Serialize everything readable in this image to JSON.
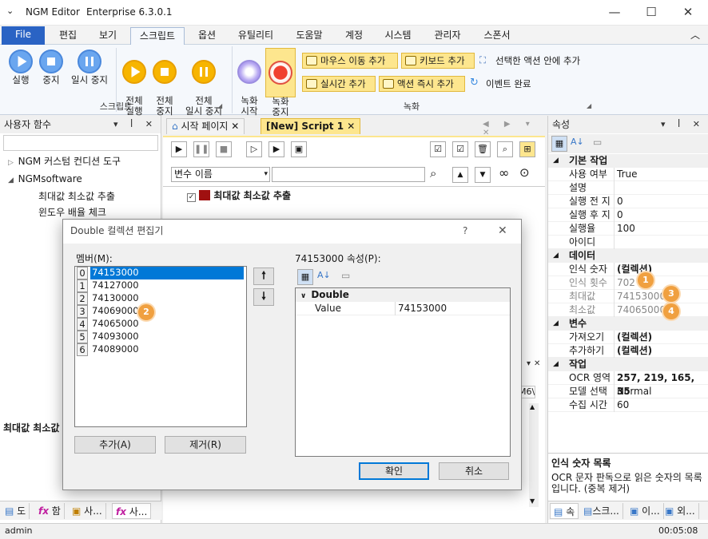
{
  "window": {
    "title": "NGM Editor",
    "edition": "Enterprise 6.3.0.1",
    "min": "—",
    "max": "☐",
    "close": "✕"
  },
  "menu": {
    "items": [
      "File",
      "편집",
      "보기",
      "스크립트",
      "옵션",
      "유틸리티",
      "도움말",
      "계정",
      "시스템",
      "관리자",
      "스폰서"
    ],
    "collapse": "︿"
  },
  "ribbon": {
    "script_buttons": [
      {
        "label": "실행"
      },
      {
        "label": "중지"
      },
      {
        "label": "일시 중지"
      }
    ],
    "full_buttons": [
      {
        "label": "전체\n실행"
      },
      {
        "label": "전체\n중지"
      },
      {
        "label": "전체\n일시 중지"
      }
    ],
    "record_buttons": [
      {
        "label": "녹화\n시작"
      },
      {
        "label": "녹화\n중지"
      }
    ],
    "actions": [
      "마우스 이동 추가",
      "키보드 추가",
      "선택한 액션 안에 추가",
      "실시간 추가",
      "액션 즉시 추가",
      "이벤트 완료"
    ],
    "group_script": "스크립트",
    "group_record": "녹화"
  },
  "left_panel": {
    "title": "사용자 함수",
    "pin": "▾ ✕",
    "tree": [
      "NGM 커스텀 컨디션 도구",
      "NGMsoftware",
      "최대값 최소값 추출",
      "윈도우 배율 체크"
    ],
    "bottom_label": "최대값 최소값 추출",
    "tabs": [
      "도",
      "함",
      "사...",
      "사..."
    ]
  },
  "doc": {
    "tabs": [
      "시작 페이지",
      "[New] Script 1"
    ],
    "close": "✕",
    "combo": "변수 이름",
    "script_item": "최대값 최소값 추출",
    "partial_text": "M6\\"
  },
  "right_panel": {
    "title": "속성",
    "rows": [
      {
        "cat": "기본 작업"
      },
      {
        "k": "사용 여부",
        "v": "True"
      },
      {
        "k": "설명",
        "v": ""
      },
      {
        "k": "실행 전 지",
        "v": "0"
      },
      {
        "k": "실행 후 지",
        "v": "0"
      },
      {
        "k": "실행율",
        "v": "100"
      },
      {
        "k": "아이디",
        "v": ""
      },
      {
        "cat": "데이터"
      },
      {
        "k": "인식 숫자",
        "v": "(컬렉션)",
        "bold": true
      },
      {
        "k": "인식 횟수",
        "v": "702",
        "gray": true
      },
      {
        "k": "최대값",
        "v": "74153000",
        "gray": true
      },
      {
        "k": "최소값",
        "v": "74065000",
        "gray": true
      },
      {
        "cat": "변수"
      },
      {
        "k": "가져오기",
        "v": "(컬렉션)",
        "bold": true
      },
      {
        "k": "추가하기",
        "v": "(컬렉션)",
        "bold": true
      },
      {
        "cat": "작업"
      },
      {
        "k": "OCR 영역",
        "v": "257, 219, 165, 35",
        "bold": true
      },
      {
        "k": "모델 선택",
        "v": "Normal"
      },
      {
        "k": "수집 시간",
        "v": "60"
      }
    ],
    "desc_title": "인식 숫자 목록",
    "desc_text": "OCR 문자 판독으로 읽은 숫자의 목록입니다. (중복 제거)",
    "tabs": [
      "속",
      "스크...",
      "이...",
      "외..."
    ],
    "badges": [
      "1",
      "3",
      "4"
    ]
  },
  "dialog": {
    "title": "Double 컬렉션 편집기",
    "help": "?",
    "close": "✕",
    "members_label": "멤버(M):",
    "members": [
      {
        "i": "0",
        "v": "74153000"
      },
      {
        "i": "1",
        "v": "74127000"
      },
      {
        "i": "2",
        "v": "74130000"
      },
      {
        "i": "3",
        "v": "74069000"
      },
      {
        "i": "4",
        "v": "74065000"
      },
      {
        "i": "5",
        "v": "74093000"
      },
      {
        "i": "6",
        "v": "74089000"
      }
    ],
    "props_label": "74153000 속성(P):",
    "prop_cat": "Double",
    "prop_key": "Value",
    "prop_val": "74153000",
    "add": "추가(A)",
    "remove": "제거(R)",
    "ok": "확인",
    "cancel": "취소",
    "badge": "2"
  },
  "status": {
    "user": "admin",
    "time": "00:05:08"
  }
}
